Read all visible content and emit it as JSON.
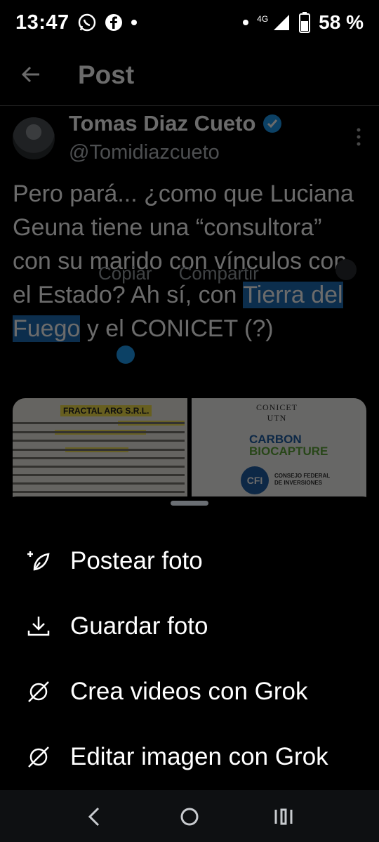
{
  "status_bar": {
    "time": "13:47",
    "network": "4G",
    "battery": "58 %",
    "icons": [
      "whatsapp-icon",
      "facebook-icon",
      "dot-icon",
      "dot-icon",
      "signal-icon",
      "battery-icon"
    ]
  },
  "header": {
    "title": "Post"
  },
  "post": {
    "author_name": "Tomas Diaz Cueto",
    "handle": "@Tomidiazcueto",
    "text_before": "Pero pará... ¿como que Luciana Geuna tiene una “consultora” con su marido con vínculos con el Estado? Ah sí, con ",
    "text_selected": "Tierra del Fuego",
    "text_after": " y el CONICET (?)",
    "selection_menu": {
      "copy": "Copiar",
      "share": "Compartir"
    },
    "image1": {
      "title": "FRACTAL ARG S.R.L."
    },
    "image2": {
      "header_line1": "CONICET",
      "header_line2": "UTN",
      "carbon_line1": "CARBON",
      "carbon_line2": "BIOCAPTURE",
      "cfi_badge": "CFI",
      "cfi_line1": "CONSEJO FEDERAL",
      "cfi_line2": "DE INVERSIONES"
    }
  },
  "sheet": {
    "options": [
      {
        "label": "Postear foto",
        "icon": "post-photo-icon"
      },
      {
        "label": "Guardar foto",
        "icon": "download-icon"
      },
      {
        "label": "Crea videos con Grok",
        "icon": "grok-icon"
      },
      {
        "label": "Editar imagen con Grok",
        "icon": "grok-icon"
      }
    ]
  },
  "colors": {
    "accent": "#1d9bf0",
    "background": "#000000",
    "text": "#ffffff"
  }
}
